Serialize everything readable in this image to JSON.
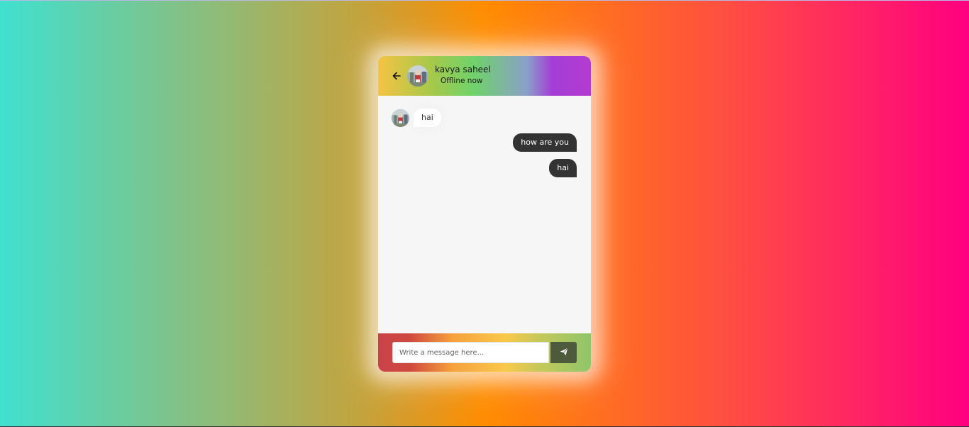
{
  "header": {
    "back_icon": "arrow-left-icon",
    "user_name": "kavya saheel",
    "status": "Offline now"
  },
  "messages": [
    {
      "direction": "incoming",
      "text": "hai"
    },
    {
      "direction": "outgoing",
      "text": "how are you"
    },
    {
      "direction": "outgoing",
      "text": "hai"
    }
  ],
  "composer": {
    "placeholder": "Write a message here...",
    "value": "",
    "send_icon": "paper-plane-icon"
  },
  "colors": {
    "outgoing_bubble": "#333333",
    "incoming_bubble": "#ffffff",
    "send_button": "#4d5a3c",
    "chat_background": "#f6f6f6"
  }
}
